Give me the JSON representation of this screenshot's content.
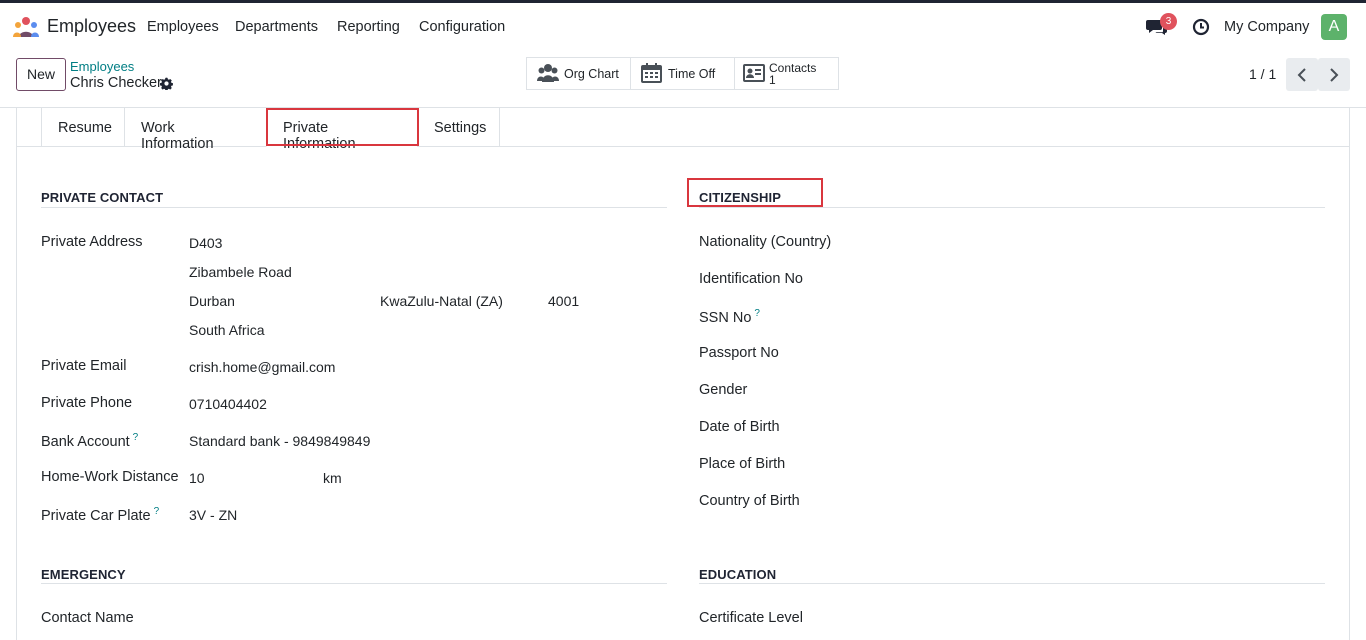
{
  "app": {
    "name": "Employees"
  },
  "menu": [
    "Employees",
    "Departments",
    "Reporting",
    "Configuration"
  ],
  "navbar": {
    "chat_badge": "3",
    "company": "My Company",
    "avatar_letter": "A"
  },
  "control": {
    "new_label": "New",
    "breadcrumb_parent": "Employees",
    "breadcrumb_current": "Chris Checker",
    "smart_buttons": {
      "org_chart": "Org Chart",
      "time_off": "Time Off",
      "contacts": "Contacts",
      "contacts_count": "1"
    },
    "pager": "1 / 1"
  },
  "tabs": [
    "Resume",
    "Work Information",
    "Private Information",
    "Settings"
  ],
  "private_contact": {
    "title": "PRIVATE CONTACT",
    "address_label": "Private Address",
    "street": "D403",
    "street2": "Zibambele Road",
    "city": "Durban",
    "state": "KwaZulu-Natal (ZA)",
    "zip": "4001",
    "country": "South Africa",
    "email_label": "Private Email",
    "email": "crish.home@gmail.com",
    "phone_label": "Private Phone",
    "phone": "0710404402",
    "bank_label": "Bank Account",
    "bank": "Standard bank - 9849849849",
    "distance_label": "Home-Work Distance",
    "distance": "10",
    "distance_unit": "km",
    "car_label": "Private Car Plate",
    "car": "3V - ZN"
  },
  "citizenship": {
    "title": "CITIZENSHIP",
    "labels": [
      "Nationality (Country)",
      "Identification No",
      "SSN No",
      "Passport No",
      "Gender",
      "Date of Birth",
      "Place of Birth",
      "Country of Birth"
    ]
  },
  "emergency": {
    "title": "EMERGENCY",
    "contact_label": "Contact Name"
  },
  "education": {
    "title": "EDUCATION",
    "certificate_label": "Certificate Level"
  },
  "help_mark": "?",
  "colors": {
    "brand": "#714b67",
    "link": "#017e84",
    "highlight": "#d9363e",
    "avatar": "#5db26b",
    "badge": "#e0525d"
  }
}
